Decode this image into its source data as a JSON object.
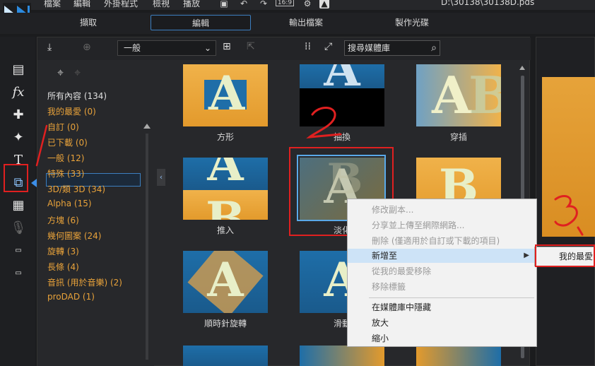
{
  "menubar": {
    "items": [
      "檔案",
      "編輯",
      "外掛程式",
      "檢視",
      "播放"
    ],
    "aspect_ratio": "16:9",
    "project_path": "D:\\30138\\30138D.pds"
  },
  "mode_tabs": [
    "擷取",
    "編輯",
    "輸出檔案",
    "製作光碟"
  ],
  "library": {
    "category_select": "一般",
    "search_placeholder": "搜尋媒體庫"
  },
  "categories": [
    {
      "label": "所有內容 (134)"
    },
    {
      "label": "我的最愛 (0)"
    },
    {
      "label": "自訂 (0)"
    },
    {
      "label": "已下載 (0)"
    },
    {
      "label": "一般 (12)"
    },
    {
      "label": "特殊 (33)"
    },
    {
      "label": "3D/類 3D (34)"
    },
    {
      "label": "Alpha (15)"
    },
    {
      "label": "方塊 (6)"
    },
    {
      "label": "幾何圖案 (24)"
    },
    {
      "label": "旋轉 (3)"
    },
    {
      "label": "長條 (4)"
    },
    {
      "label": "音訊 (用於音樂) (2)"
    },
    {
      "label": "proDAD (1)"
    }
  ],
  "thumbnails": [
    {
      "label": "方形"
    },
    {
      "label": "抽換"
    },
    {
      "label": "穿插"
    },
    {
      "label": "推入"
    },
    {
      "label": "淡化"
    },
    {
      "label": ""
    },
    {
      "label": "順時針旋轉"
    },
    {
      "label": "滑動"
    }
  ],
  "context_menu": {
    "items": [
      "修改副本...",
      "分享並上傳至網際網路...",
      "刪除 (僅適用於自訂或下載的項目)",
      "新增至",
      "從我的最愛移除",
      "移除標籤",
      "在媒體庫中隱藏",
      "放大",
      "縮小"
    ],
    "submenu_item": "我的最愛"
  },
  "colors": {
    "accent_blue": "#3c7fc0",
    "annotation_red": "#e02020",
    "category_orange": "#e8a23a"
  }
}
